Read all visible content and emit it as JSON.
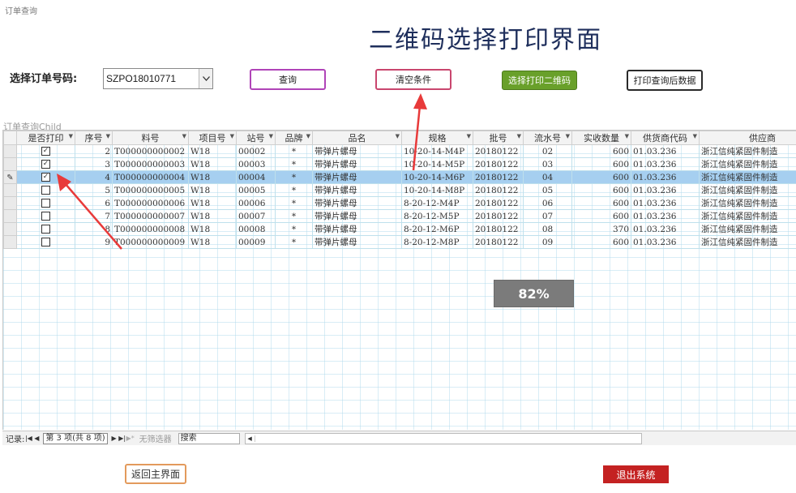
{
  "window": {
    "caption": "订单查询"
  },
  "title": "二维码选择打印界面",
  "order_select": {
    "label": "选择订单号码:",
    "value": "SZPO18010771",
    "dropdown_icon": "chevron-down-icon"
  },
  "buttons": {
    "query": "查询",
    "clear": "清空条件",
    "select_print": "选择打印二维码",
    "print_after_query": "打印查询后数据",
    "back": "返回主界面",
    "exit": "退出系统"
  },
  "colors": {
    "select_print_bg": "#69a02a",
    "exit_bg": "#c42222",
    "row_highlight": "#a6cff0"
  },
  "subform": {
    "caption": "订单查询Child"
  },
  "table": {
    "columns": [
      "是否打印",
      "序号",
      "料号",
      "项目号",
      "站号",
      "品牌",
      "品名",
      "规格",
      "批号",
      "流水号",
      "实收数量",
      "供货商代码",
      "供应商"
    ],
    "rows": [
      {
        "checked": true,
        "current": false,
        "cells": [
          "2",
          "T000000000002",
          "W18",
          "00002",
          "*",
          "带弹片螺母",
          "10-20-14-M4P",
          "20180122",
          "02",
          "600",
          "01.03.236",
          "浙江信纯紧固件制造"
        ]
      },
      {
        "checked": true,
        "current": false,
        "cells": [
          "3",
          "T000000000003",
          "W18",
          "00003",
          "*",
          "带弹片螺母",
          "10-20-14-M5P",
          "20180122",
          "03",
          "600",
          "01.03.236",
          "浙江信纯紧固件制造"
        ]
      },
      {
        "checked": true,
        "current": true,
        "cells": [
          "4",
          "T000000000004",
          "W18",
          "00004",
          "*",
          "带弹片螺母",
          "10-20-14-M6P",
          "20180122",
          "04",
          "600",
          "01.03.236",
          "浙江信纯紧固件制造"
        ]
      },
      {
        "checked": false,
        "current": false,
        "cells": [
          "5",
          "T000000000005",
          "W18",
          "00005",
          "*",
          "带弹片螺母",
          "10-20-14-M8P",
          "20180122",
          "05",
          "600",
          "01.03.236",
          "浙江信纯紧固件制造"
        ]
      },
      {
        "checked": false,
        "current": false,
        "cells": [
          "6",
          "T000000000006",
          "W18",
          "00006",
          "*",
          "带弹片螺母",
          "8-20-12-M4P",
          "20180122",
          "06",
          "600",
          "01.03.236",
          "浙江信纯紧固件制造"
        ]
      },
      {
        "checked": false,
        "current": false,
        "cells": [
          "7",
          "T000000000007",
          "W18",
          "00007",
          "*",
          "带弹片螺母",
          "8-20-12-M5P",
          "20180122",
          "07",
          "600",
          "01.03.236",
          "浙江信纯紧固件制造"
        ]
      },
      {
        "checked": false,
        "current": false,
        "cells": [
          "8",
          "T000000000008",
          "W18",
          "00008",
          "*",
          "带弹片螺母",
          "8-20-12-M6P",
          "20180122",
          "08",
          "370",
          "01.03.236",
          "浙江信纯紧固件制造"
        ]
      },
      {
        "checked": false,
        "current": false,
        "cells": [
          "9",
          "T000000000009",
          "W18",
          "00009",
          "*",
          "带弹片螺母",
          "8-20-12-M8P",
          "20180122",
          "09",
          "600",
          "01.03.236",
          "浙江信纯紧固件制造"
        ]
      }
    ],
    "current_row_icon": "pencil-icon",
    "sort_icon": "sort-arrow-icon"
  },
  "navigator": {
    "label": "记录:",
    "position": "第 3 项(共 8 项)",
    "first": "|◀",
    "prev": "◀",
    "next": "▶",
    "last": "▶|",
    "new": "▶*",
    "filter": "无筛选器",
    "search": "搜索",
    "scroll_left": "◀"
  },
  "overlay": {
    "progress_text": "82%",
    "progress_value": 0.82
  }
}
